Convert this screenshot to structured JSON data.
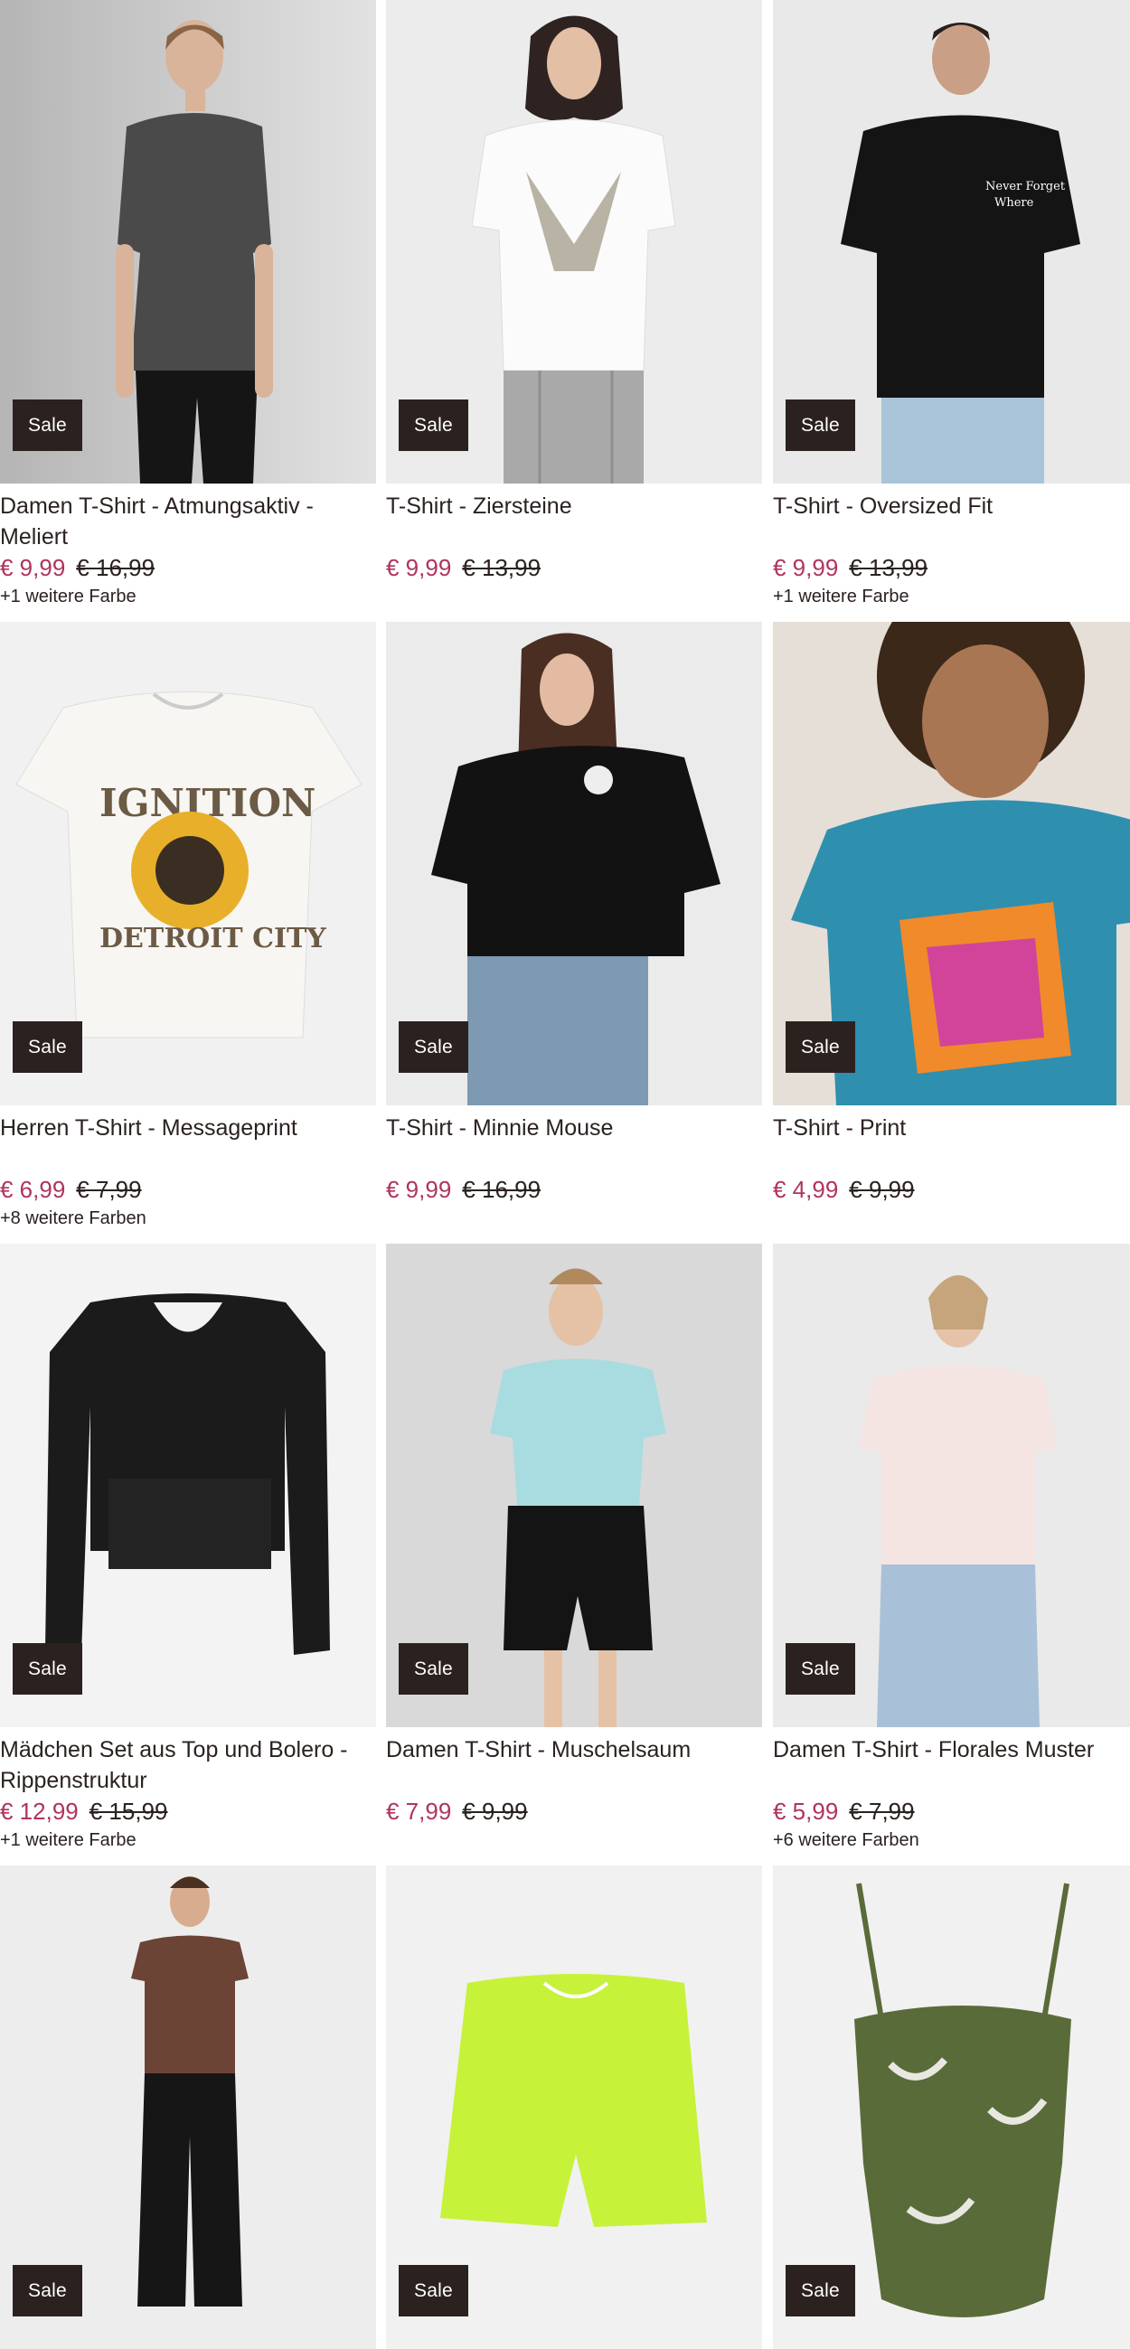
{
  "sale_badge": "Sale",
  "colors": {
    "sale_price": "#b0345e",
    "badge_bg": "#2b2220",
    "text": "#2b2220"
  },
  "products": [
    {
      "title": "Damen T-Shirt - Atmungsaktiv - Meliert",
      "price": "€ 9,99",
      "old_price": "€ 16,99",
      "colors_text": "+1 weitere Farbe"
    },
    {
      "title": "T-Shirt - Ziersteine",
      "price": "€ 9,99",
      "old_price": "€ 13,99",
      "colors_text": ""
    },
    {
      "title": "T-Shirt - Oversized Fit",
      "price": "€ 9,99",
      "old_price": "€ 13,99",
      "colors_text": "+1 weitere Farbe"
    },
    {
      "title": "Herren T-Shirt - Messageprint",
      "price": "€ 6,99",
      "old_price": "€ 7,99",
      "colors_text": "+8 weitere Farben"
    },
    {
      "title": "T-Shirt - Minnie Mouse",
      "price": "€ 9,99",
      "old_price": "€ 16,99",
      "colors_text": ""
    },
    {
      "title": "T-Shirt - Print",
      "price": "€ 4,99",
      "old_price": "€ 9,99",
      "colors_text": ""
    },
    {
      "title": "Mädchen Set aus Top und Bolero - Rippenstruktur",
      "price": "€ 12,99",
      "old_price": "€ 15,99",
      "colors_text": "+1 weitere Farbe"
    },
    {
      "title": "Damen T-Shirt - Muschelsaum",
      "price": "€ 7,99",
      "old_price": "€ 9,99",
      "colors_text": ""
    },
    {
      "title": "Damen T-Shirt - Florales Muster",
      "price": "€ 5,99",
      "old_price": "€ 7,99",
      "colors_text": "+6 weitere Farben"
    },
    {
      "title": "",
      "price": "",
      "old_price": "",
      "colors_text": ""
    },
    {
      "title": "",
      "price": "",
      "old_price": "",
      "colors_text": ""
    },
    {
      "title": "",
      "price": "",
      "old_price": "",
      "colors_text": ""
    }
  ]
}
